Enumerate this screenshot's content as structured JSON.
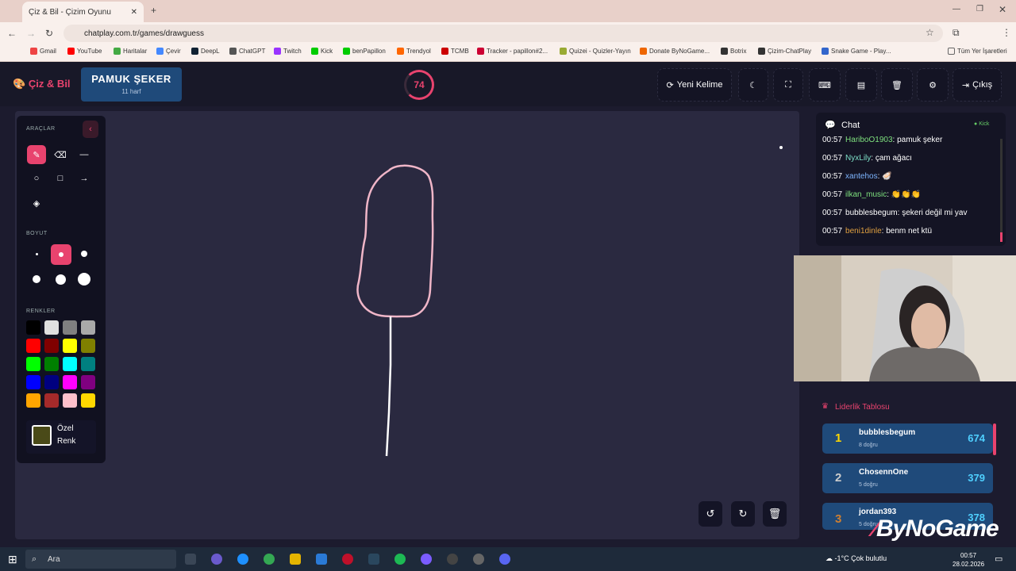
{
  "browser": {
    "tab_title": "Çiz & Bil - Çizim Oyunu",
    "url": "chatplay.com.tr/games/drawguess",
    "bookmarks": [
      "Gmail",
      "YouTube",
      "Haritalar",
      "Çevir",
      "DeepL",
      "ChatGPT",
      "Twitch",
      "Kick",
      "benPapillon",
      "Trendyol",
      "TCMB",
      "Tracker - papillon#2...",
      "Quizei - Quizler-Yayın",
      "Donate ByNoGame...",
      "Botrix",
      "Çizim-ChatPlay",
      "Snake Game - Play..."
    ],
    "all_bookmarks": "Tüm Yer İşaretleri"
  },
  "header": {
    "logo": "Çiz & Bil",
    "word": "PAMUK ŞEKER",
    "word_hint": "11 harf",
    "timer": "74",
    "new_word": "Yeni Kelime",
    "exit": "Çıkış"
  },
  "tools": {
    "title": "ARAÇLAR",
    "size_title": "BOYUT",
    "colors_title": "RENKLER",
    "custom_label": "Özel Renk",
    "palette": [
      "#000000",
      "#e0e0e0",
      "#808080",
      "#a9a9a9",
      "#ff0000",
      "#800000",
      "#ffff00",
      "#808000",
      "#00ff00",
      "#008000",
      "#00ffff",
      "#008080",
      "#0000ff",
      "#000080",
      "#ff00ff",
      "#800080",
      "#ffa500",
      "#a52a2a",
      "#ffc0cb",
      "#ffd700"
    ]
  },
  "chat": {
    "title": "Chat",
    "source": "Kick",
    "messages": [
      {
        "time": "00:57",
        "user": "HariboO1903",
        "text": ": pamuk şeker",
        "color": "#7ee07e"
      },
      {
        "time": "00:57",
        "user": "NyxLily",
        "text": ": çam ağacı",
        "color": "#7ee0c8"
      },
      {
        "time": "00:57",
        "user": "xantehos",
        "text": ": 🦪",
        "color": "#7eb6ff"
      },
      {
        "time": "00:57",
        "user": "ilkan_music",
        "text": ": 👏👏👏",
        "color": "#7ee07e"
      },
      {
        "time": "00:57",
        "user": "bubblesbegum",
        "text": ": şekeri değil mi yav",
        "color": "#ffffff"
      },
      {
        "time": "00:57",
        "user": "beni1dinle",
        "text": ": benm net ktü",
        "color": "#e0a040"
      }
    ]
  },
  "leaderboard": {
    "title": "Liderlik Tablosu",
    "rows": [
      {
        "rank": "1",
        "name": "bubblesbegum",
        "sub": "8 doğru",
        "score": "674"
      },
      {
        "rank": "2",
        "name": "ChosennOne",
        "sub": "5 doğru",
        "score": "379"
      },
      {
        "rank": "3",
        "name": "jordan393",
        "sub": "5 doğru",
        "score": "378"
      }
    ]
  },
  "overlay": {
    "brand": "ByNoGame"
  },
  "taskbar": {
    "search": "Ara",
    "weather": "-1°C  Çok bulutlu",
    "time": "00:57",
    "date": "28.02.2026"
  },
  "colors": {
    "accent": "#e8436e",
    "panel": "#1f4a7a"
  }
}
